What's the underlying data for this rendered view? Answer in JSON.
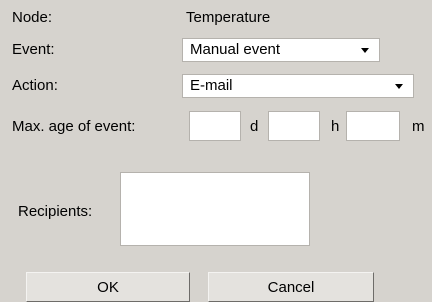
{
  "form": {
    "node_label": "Node:",
    "node_value": "Temperature",
    "event_label": "Event:",
    "event_value": "Manual event",
    "action_label": "Action:",
    "action_value": "E-mail",
    "max_age_label": "Max. age of event:",
    "days_value": "",
    "days_unit": "d",
    "hours_value": "",
    "hours_unit": "h",
    "minutes_value": "",
    "minutes_unit": "m",
    "recipients_label": "Recipients:",
    "recipients_value": ""
  },
  "buttons": {
    "ok_label": "OK",
    "cancel_label": "Cancel"
  },
  "icons": {
    "dropdown_arrow": "chevron-down-icon"
  }
}
